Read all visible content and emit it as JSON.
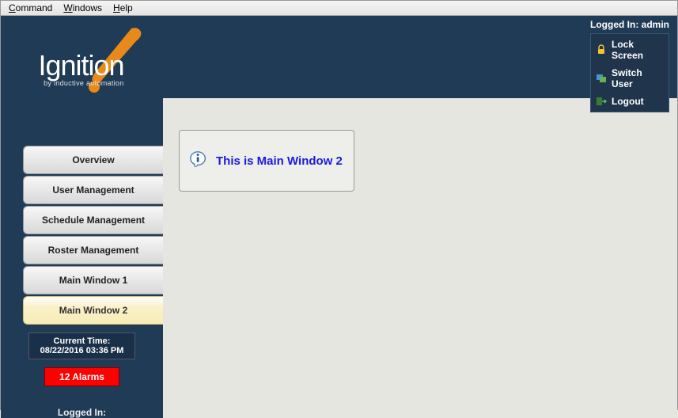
{
  "menubar": {
    "command": "Command",
    "windows": "Windows",
    "help": "Help"
  },
  "brand": {
    "name": "Ignition",
    "tagline": "by inductive automation"
  },
  "sidebar": {
    "items": [
      {
        "label": "Overview"
      },
      {
        "label": "User Management"
      },
      {
        "label": "Schedule Management"
      },
      {
        "label": "Roster Management"
      },
      {
        "label": "Main Window 1"
      },
      {
        "label": "Main Window 2"
      }
    ]
  },
  "footer": {
    "timeLabel": "Current Time:",
    "timeValue": "08/22/2016 03:36 PM",
    "alarmText": "12 Alarms",
    "loggedIn": "Logged In:"
  },
  "header": {
    "loggedIn": "Logged In: admin",
    "lock": "Lock Screen",
    "switch": "Switch User",
    "logout": "Logout"
  },
  "main": {
    "infoText": "This is Main Window 2"
  }
}
